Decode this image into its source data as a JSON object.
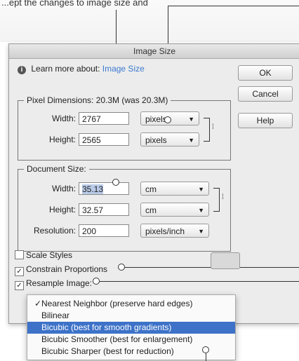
{
  "caption": "...ept the changes to image size and",
  "dialog": {
    "title": "Image Size",
    "learn_more_prefix": "Learn more about:",
    "learn_more_link": "Image Size",
    "buttons": {
      "ok": "OK",
      "cancel": "Cancel",
      "help": "Help"
    }
  },
  "pixel_dimensions": {
    "legend": "Pixel Dimensions:  20.3M (was 20.3M)",
    "width_label": "Width:",
    "width_value": "2767",
    "width_unit": "pixels",
    "height_label": "Height:",
    "height_value": "2565",
    "height_unit": "pixels"
  },
  "document_size": {
    "legend": "Document Size:",
    "width_label": "Width:",
    "width_value": "35.13",
    "width_unit": "cm",
    "height_label": "Height:",
    "height_value": "32.57",
    "height_unit": "cm",
    "resolution_label": "Resolution:",
    "resolution_value": "200",
    "resolution_unit": "pixels/inch"
  },
  "checkboxes": {
    "scale_styles": {
      "label": "Scale Styles",
      "checked": false
    },
    "constrain": {
      "label": "Constrain Proportions",
      "checked": true
    },
    "resample": {
      "label": "Resample Image:",
      "checked": true
    }
  },
  "resample_menu": {
    "options": [
      {
        "label": "Nearest Neighbor (preserve hard edges)",
        "checked": true
      },
      {
        "label": "Bilinear",
        "checked": false
      },
      {
        "label": "Bicubic (best for smooth gradients)",
        "highlighted": true
      },
      {
        "label": "Bicubic Smoother (best for enlargement)",
        "checked": false
      },
      {
        "label": "Bicubic Sharper (best for reduction)",
        "checked": false
      }
    ]
  },
  "icons": {
    "info": "info-icon",
    "dropdown": "chevron-down-icon",
    "link": "chain-link-icon",
    "check": "checkmark-icon"
  }
}
